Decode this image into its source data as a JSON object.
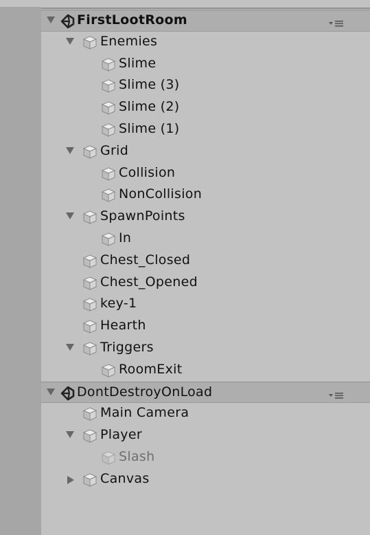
{
  "hierarchy": {
    "scenes": [
      {
        "name": "FirstLootRoom",
        "bold": true,
        "items": [
          {
            "label": "Enemies",
            "depth": 1,
            "expander": "down"
          },
          {
            "label": "Slime",
            "depth": 2
          },
          {
            "label": "Slime (3)",
            "depth": 2
          },
          {
            "label": "Slime (2)",
            "depth": 2
          },
          {
            "label": "Slime (1)",
            "depth": 2
          },
          {
            "label": "Grid",
            "depth": 1,
            "expander": "down"
          },
          {
            "label": "Collision",
            "depth": 2
          },
          {
            "label": "NonCollision",
            "depth": 2
          },
          {
            "label": "SpawnPoints",
            "depth": 1,
            "expander": "down"
          },
          {
            "label": "In",
            "depth": 2
          },
          {
            "label": "Chest_Closed",
            "depth": 1
          },
          {
            "label": "Chest_Opened",
            "depth": 1
          },
          {
            "label": "key-1",
            "depth": 1
          },
          {
            "label": "Hearth",
            "depth": 1
          },
          {
            "label": "Triggers",
            "depth": 1,
            "expander": "down"
          },
          {
            "label": "RoomExit",
            "depth": 2
          }
        ]
      },
      {
        "name": "DontDestroyOnLoad",
        "bold": false,
        "items": [
          {
            "label": "Main Camera",
            "depth": 1
          },
          {
            "label": "Player",
            "depth": 1,
            "expander": "down"
          },
          {
            "label": "Slash",
            "depth": 2,
            "disabled": true
          },
          {
            "label": "Canvas",
            "depth": 1,
            "expander": "right"
          }
        ]
      }
    ]
  },
  "icons": {
    "scene": "unity-logo-icon",
    "object": "gameobject-cube-icon",
    "menu": "context-menu-icon",
    "expand": "triangle-down-icon",
    "collapse": "triangle-right-icon"
  },
  "colors": {
    "background": "#c2c2c2",
    "scene_row": "#aeaeae",
    "gutter": "#a6a6a6",
    "text": "#111111",
    "disabled_text": "#6f6f6f"
  }
}
